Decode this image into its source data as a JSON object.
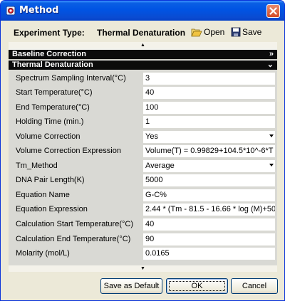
{
  "window": {
    "title": "Method"
  },
  "header": {
    "experiment_label": "Experiment Type:",
    "experiment_value": "Thermal Denaturation",
    "open_label": "Open",
    "save_label": "Save"
  },
  "sections": {
    "baseline": {
      "label": "Baseline Correction",
      "chevron": "»"
    },
    "thermal": {
      "label": "Thermal Denaturation",
      "chevron": "⌄"
    }
  },
  "rows": [
    {
      "label": "Spectrum Sampling Interval(°C)",
      "value": "3"
    },
    {
      "label": "Start Temperature(°C)",
      "value": "40"
    },
    {
      "label": "End Temperature(°C)",
      "value": "100"
    },
    {
      "label": "Holding Time (min.)",
      "value": "1"
    },
    {
      "label": "Volume Correction",
      "value": "Yes"
    },
    {
      "label": "Volume Correction Expression",
      "value": "Volume(T) = 0.99829+104.5*10^-6*T"
    },
    {
      "label": "Tm_Method",
      "value": "Average"
    },
    {
      "label": "DNA Pair Length(K)",
      "value": "5000"
    },
    {
      "label": "Equation Name",
      "value": "G-C%"
    },
    {
      "label": "Equation Expression",
      "value": "2.44 * (Tm - 81.5 - 16.66 * log (M)+50"
    },
    {
      "label": "Calculation Start Temperature(°C)",
      "value": "40"
    },
    {
      "label": "Calculation End Temperature(°C)",
      "value": "90"
    },
    {
      "label": "Molarity (mol/L)",
      "value": "0.0165"
    }
  ],
  "buttons": {
    "save_default": "Save as Default",
    "ok": "OK",
    "cancel": "Cancel"
  }
}
